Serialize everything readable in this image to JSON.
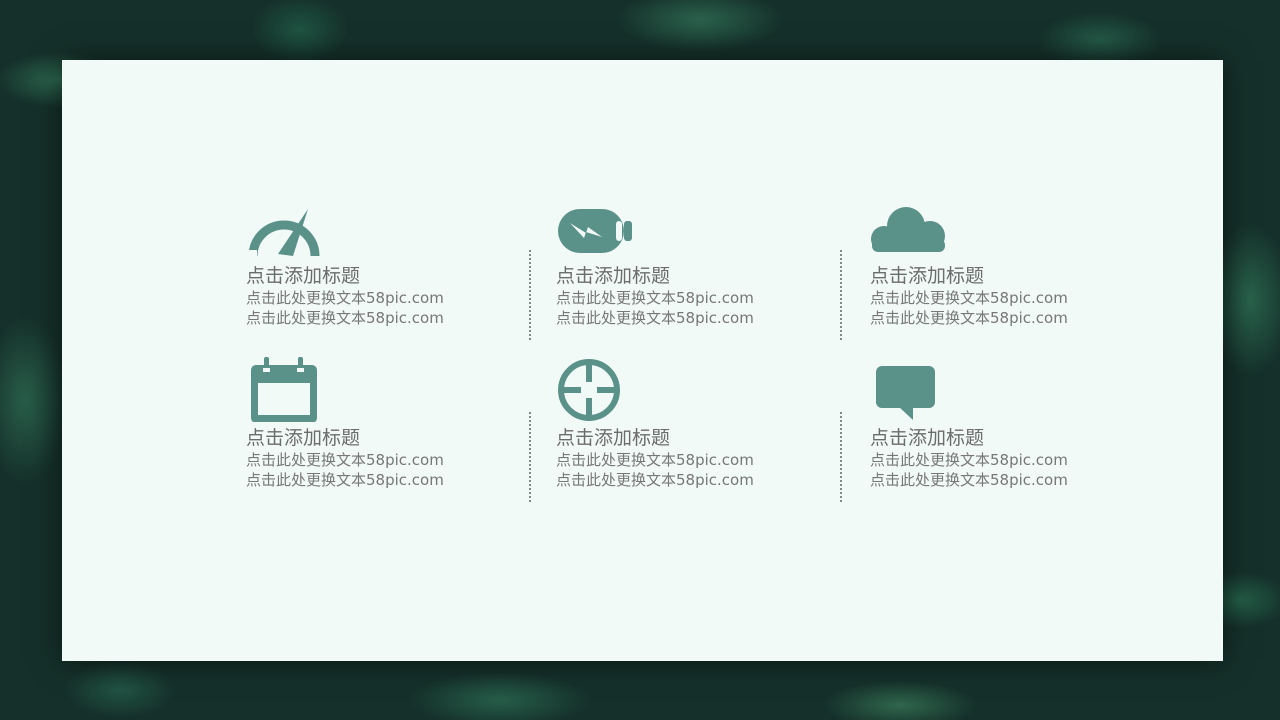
{
  "theme": {
    "accent": "#5a9289",
    "card_bg": "#f2faf8",
    "text": "#6c6c6c"
  },
  "items": [
    {
      "icon": "speedometer-icon",
      "title": "点击添加标题",
      "line1": "点击此处更换文本58pic.com",
      "line2": "点击此处更换文本58pic.com"
    },
    {
      "icon": "battery-charging-icon",
      "title": "点击添加标题",
      "line1": "点击此处更换文本58pic.com",
      "line2": "点击此处更换文本58pic.com"
    },
    {
      "icon": "cloud-icon",
      "title": "点击添加标题",
      "line1": "点击此处更换文本58pic.com",
      "line2": "点击此处更换文本58pic.com"
    },
    {
      "icon": "calendar-icon",
      "title": "点击添加标题",
      "line1": "点击此处更换文本58pic.com",
      "line2": "点击此处更换文本58pic.com"
    },
    {
      "icon": "crosshair-icon",
      "title": "点击添加标题",
      "line1": "点击此处更换文本58pic.com",
      "line2": "点击此处更换文本58pic.com"
    },
    {
      "icon": "speech-bubble-icon",
      "title": "点击添加标题",
      "line1": "点击此处更换文本58pic.com",
      "line2": "点击此处更换文本58pic.com"
    }
  ]
}
